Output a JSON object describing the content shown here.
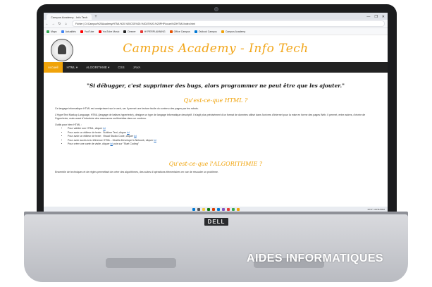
{
  "browser": {
    "tab_title": "Campus Academy - Info Tech",
    "new_tab": "+",
    "window_controls": [
      "—",
      "❐",
      "✕"
    ],
    "nav_buttons": [
      "←",
      "→",
      "↻",
      "⌂"
    ],
    "url": "Fichier | D:/Campus%20Academy/HTML%20-%20CSS%20-%20JS%20-%20PHP/cours%20HTML/index.html",
    "bookmarks": [
      {
        "label": "Maps",
        "color": "#34a853"
      },
      {
        "label": "Actualités",
        "color": "#4285f4"
      },
      {
        "label": "YouTube",
        "color": "#ff0000"
      },
      {
        "label": "YouTube Music",
        "color": "#ff0000"
      },
      {
        "label": "Deezer",
        "color": "#222222"
      },
      {
        "label": "HYPERPLANNING",
        "color": "#e53935"
      },
      {
        "label": "Office Campus",
        "color": "#e65100"
      },
      {
        "label": "Outlook Campus",
        "color": "#0078d4"
      },
      {
        "label": "Campus Academy",
        "color": "#f0a30a"
      }
    ]
  },
  "site": {
    "title": "Campus Academy - Info Tech",
    "nav": [
      "Accueil",
      "HTML ▾",
      "ALGORITHME ▾",
      "CSS",
      "JAVA"
    ],
    "quote": "\"Si débugger, c'est supprimer des bugs, alors programmer ne peut être que les ajouter.\"",
    "section1": {
      "heading": "Qu'est-ce-que HTML ?",
      "p1": "Ce langage informatique HTML est omniprésent sur le web, car il permet une lecture facile du contenu des pages par les robots.",
      "p2": "L'HyperText Markup Language, HTML (langage de balises hypertexte), désigne un type de langage informatique descriptif. Il s'agit plus précisément d'un format de données utilisé dans l'univers d'Internet pour la mise en forme des pages Web. Il permet, entre autres, d'écrire de l'hypertexte, mais aussi d'introduire des ressources multimédias dans un contenu.",
      "list_title": "Outils pour bien HTML :",
      "items": [
        {
          "text": "Pour valider son HTML, cliquer",
          "link": "ici"
        },
        {
          "text": "Pour avoir un éditeur de texte : Sublime Text, cliquer",
          "link": "ici"
        },
        {
          "text": "Pour avoir un éditeur de texte : Visual Studio Code, cliquer",
          "link": "ici"
        },
        {
          "text": "Pour avoir accès à la référence HTML - Mozilla Developer's Network, cliquer",
          "link": "ici"
        },
        {
          "text": "Pour créer une carte de visite, cliquer",
          "link": "ici",
          "suffix": "puis sur \"Start Coding\""
        }
      ]
    },
    "section2": {
      "heading": "Qu'est-ce-que l'ALGORITHMIE ?",
      "p1": "Ensemble de techniques et de règles permettant de créer des algorithmes, des suites d'opérations élémentaires en vue de résoudre un problème."
    }
  },
  "taskbar": {
    "icons": [
      "#0078d4",
      "#555555",
      "#f2c744",
      "#0f7b0f",
      "#d83b01",
      "#0078d4",
      "#7e57c2",
      "#e53935",
      "#34a853",
      "#f0a30a"
    ],
    "clock": "10:37 / 22/11/2022"
  },
  "device": {
    "brand": "DELL"
  },
  "watermark": "AIDES INFORMATIQUES"
}
